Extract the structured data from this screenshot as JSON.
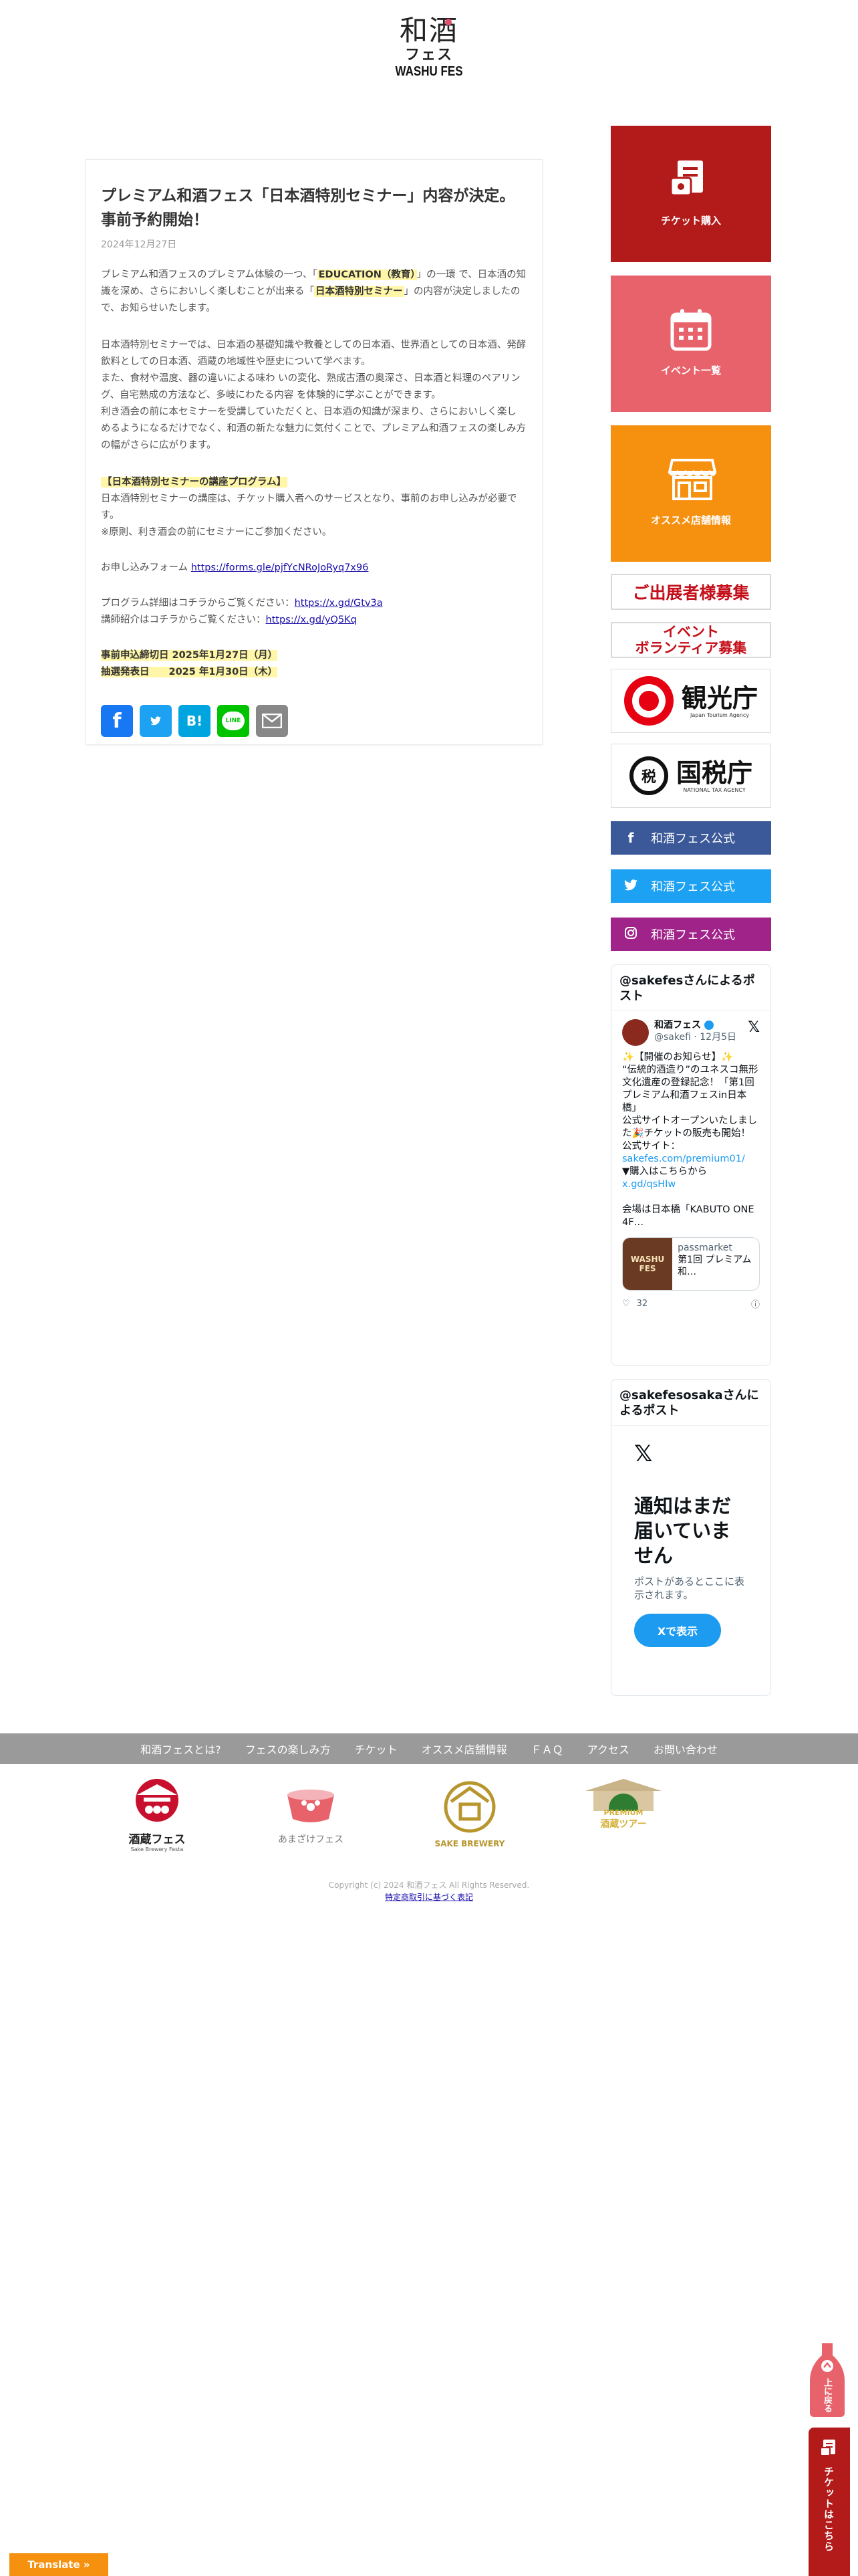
{
  "header": {
    "logo_kanji": "和酒",
    "logo_kana": "フェス",
    "logo_latin": "WASHU FES"
  },
  "article": {
    "title": "プレミアム和酒フェス「日本酒特別セミナー」内容が決定。事前予約開始！",
    "date": "2024年12月27日",
    "p1_pre": "プレミアム和酒フェスのプレミアム体験の一つ、「",
    "p1_hl1": "EDUCATION（教育）",
    "p1_mid": "」の一環 で、日本酒の知識を深め、さらにおいしく楽しむことが出来る「",
    "p1_hl2": "日本酒特別セミナー",
    "p1_post": "」の内容が決定しましたので、お知らせいたします。",
    "p2": "日本酒特別セミナーでは、日本酒の基礎知識や教養としての日本酒、世界酒としての日本酒、発酵飲料としての日本酒、酒蔵の地域性や歴史について学べます。\nまた、食材や温度、器の違いによる味わ いの変化、熟成古酒の奥深さ、日本酒と料理のペアリング、自宅熟成の方法など、多岐にわたる内容 を体験的に学ぶことができます。\n利き酒会の前に本セミナーを受講していただくと、日本酒の知識が深まり、さらにおいしく楽し めるようになるだけでなく、和酒の新たな魅力に気付くことで、プレミアム和酒フェスの楽しみ方の幅がさらに広がります。",
    "p3_hl": "【日本酒特別セミナーの講座プログラム】",
    "p3_line1": "日本酒特別セミナーの講座は、チケット購入者へのサービスとなり、事前のお申し込みが必要です。",
    "p3_line2": "※原則、利き酒会の前にセミナーにご参加ください。",
    "p4_label": "お申し込みフォーム ",
    "p4_link": "https://forms.gle/pjfYcNRoJoRyq7x96",
    "p5_label1": "プログラム詳細はコチラからご覧ください：",
    "p5_link1": "https://x.gd/Gtv3a",
    "p5_label2": "講師紹介はコチラからご覧ください：",
    "p5_link2": "https://x.gd/yQ5Kq",
    "deadline": "事前申込締切日 2025年1月27日（月）",
    "lottery": "抽選発表日　　2025 年1月30日（木）"
  },
  "share": {
    "facebook": "f",
    "hatena": "B!",
    "line": "LINE"
  },
  "sidebar": {
    "ticket_label": "チケット購入",
    "event_label": "イベント一覧",
    "shop_label": "オススメ店舗情報",
    "exhibitor_banner": "ご出展者様募集",
    "volunteer_banner_line1": "イベント",
    "volunteer_banner_line2": "ボランティア募集",
    "kankocho_name": "観光庁",
    "kankocho_en": "Japan Tourism Agency",
    "kokuzeicho_mark": "税",
    "kokuzeicho_name": "国税庁",
    "kokuzeicho_en": "NATIONAL TAX AGENCY",
    "facebook_label": "和酒フェス公式",
    "twitter_label": "和酒フェス公式",
    "instagram_label": "和酒フェス公式"
  },
  "x_timeline_1": {
    "header": "@sakefesさんによるポスト",
    "name": "和酒フェス",
    "handle": "@sakefi · 12月5日",
    "body": "✨【開催のお知らせ】✨\n“伝統的酒造り”のユネスコ無形文化遺産の登録記念！「第1回プレミアム和酒フェスin日本橋」\n公式サイトオープンいたしました🎉チケットの販売も開始！\n公式サイト：",
    "link1": "sakefes.com/premium01/",
    "body2": "▼購入はこちらから",
    "link2": "x.gd/qsHIw",
    "body3": "会場は日本橋「KABUTO ONE 4F…",
    "card_img": "WASHU FES",
    "card_site": "passmarket",
    "card_title": "第1回 プレミアム和…",
    "likes": "32"
  },
  "x_timeline_2": {
    "header": "@sakefesosakaさんによるポスト",
    "title": "通知はまだ届いていません",
    "sub": "ポストがあるとここに表示されます。",
    "button": "Xで表示"
  },
  "footer": {
    "nav": [
      "和酒フェスとは?",
      "フェスの楽しみ方",
      "チケット",
      "オススメ店舗情報",
      "ＦＡＱ",
      "アクセス",
      "お問い合わせ"
    ],
    "logo1": "酒蔵フェス",
    "logo1_en": "Sake Brewery Festa",
    "logo2": "あまざけフェス",
    "logo3": "SAKE BREWERY",
    "logo4_en": "PREMIUM",
    "logo4": "酒蔵ツアー",
    "copyright": "Copyright (c) 2024 和酒フェス All Rights Reserved.",
    "law_link": "特定商取引に基づく表記"
  },
  "floating": {
    "to_top": "上に戻る",
    "ticket": "チケットはこちら",
    "translate": "Translate »"
  }
}
